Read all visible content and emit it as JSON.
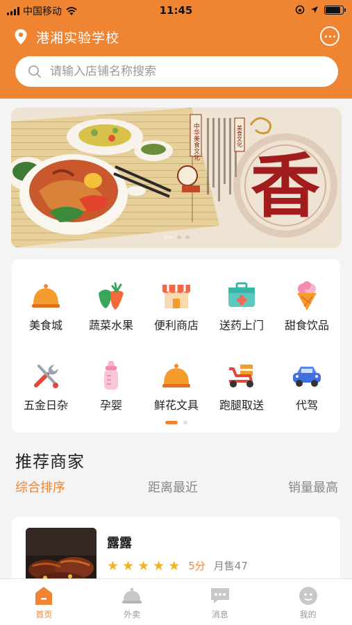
{
  "status_bar": {
    "carrier": "中国移动",
    "time": "11:45"
  },
  "header": {
    "location_title": "港湘实验学校",
    "search_placeholder": "请输入店铺名称搜索"
  },
  "banner": {
    "vertical_text_1": "中华美食文化",
    "vertical_text_2": "美食文化",
    "big_char": "香",
    "dot_count": 3,
    "active_dot": 0
  },
  "categories": [
    {
      "label": "美食城",
      "icon": "food-court-cloche-icon"
    },
    {
      "label": "蔬菜水果",
      "icon": "vegetables-fruit-icon"
    },
    {
      "label": "便利商店",
      "icon": "convenience-store-icon"
    },
    {
      "label": "送药上门",
      "icon": "medicine-kit-icon"
    },
    {
      "label": "甜食饮品",
      "icon": "ice-cream-icon"
    },
    {
      "label": "五金日杂",
      "icon": "tools-icon"
    },
    {
      "label": "孕婴",
      "icon": "baby-bottle-icon"
    },
    {
      "label": "鲜花文具",
      "icon": "flowers-stationery-cloche-icon"
    },
    {
      "label": "跑腿取送",
      "icon": "delivery-scooter-icon"
    },
    {
      "label": "代驾",
      "icon": "car-icon"
    }
  ],
  "category_pager": {
    "pages": 2,
    "active": 0
  },
  "recommend": {
    "title": "推荐商家",
    "sort_tabs": [
      "综合排序",
      "距离最近",
      "销量最高"
    ],
    "active_sort": 0
  },
  "shops": [
    {
      "name": "露露",
      "stars": 5,
      "score_label": "5分",
      "sales_label": "月售47"
    }
  ],
  "tabbar": {
    "items": [
      {
        "label": "首页",
        "icon": "home-icon"
      },
      {
        "label": "外卖",
        "icon": "takeout-cloche-icon"
      },
      {
        "label": "消息",
        "icon": "message-icon"
      },
      {
        "label": "我的",
        "icon": "profile-icon"
      }
    ],
    "active": 0
  },
  "colors": {
    "accent": "#ef8432",
    "star": "#f5b21c",
    "background": "#f4f4f4"
  }
}
